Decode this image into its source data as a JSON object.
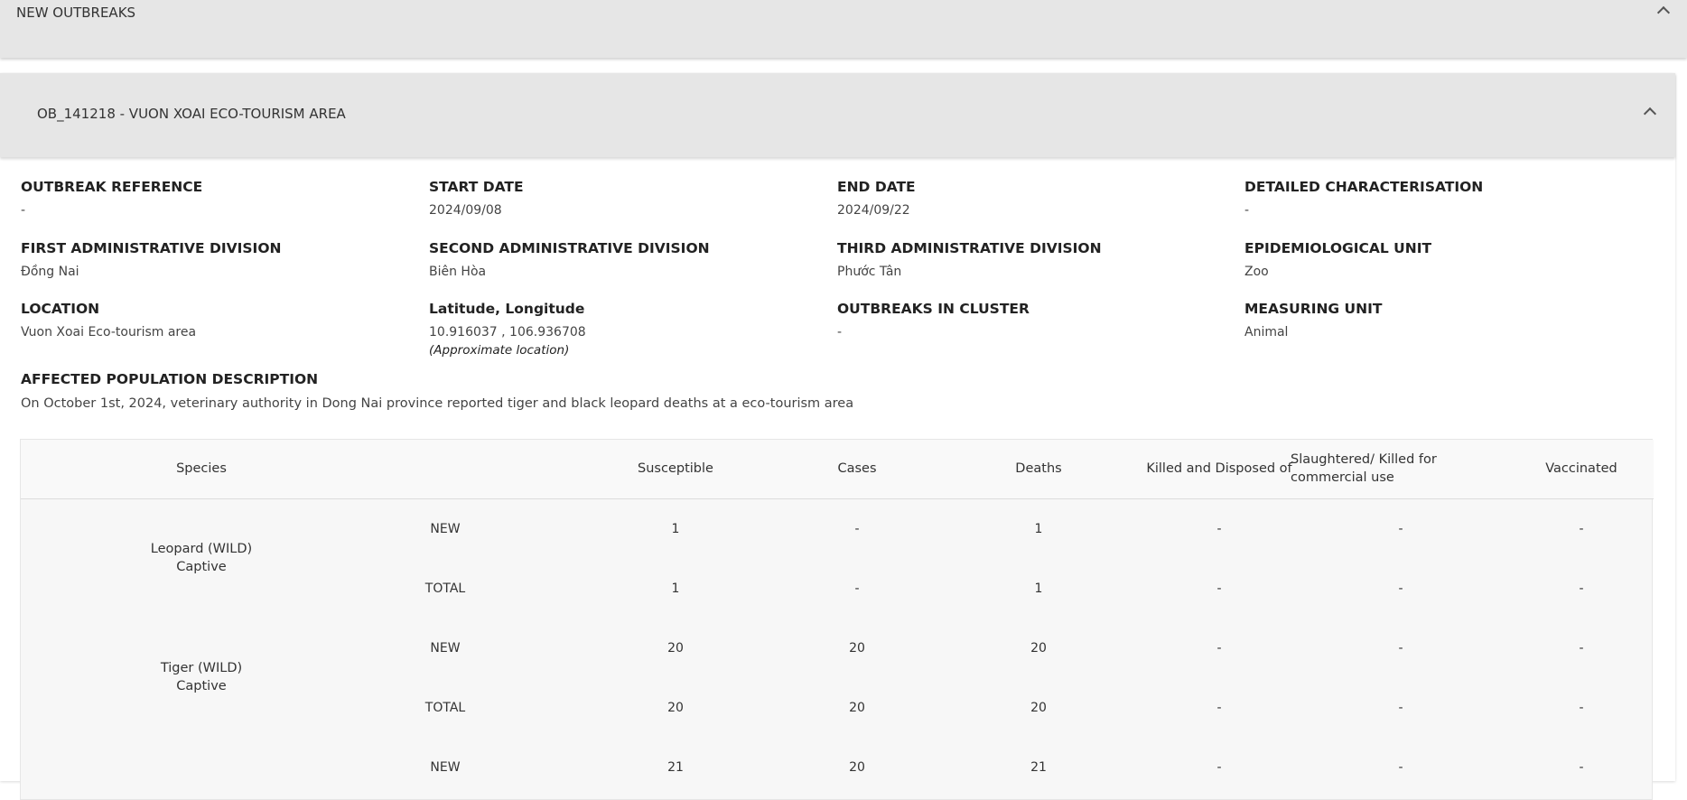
{
  "new_outbreaks": {
    "title": "NEW OUTBREAKS"
  },
  "outbreak": {
    "title": "OB_141218 - VUON XOAI ECO-TOURISM AREA",
    "fields": {
      "outbreak_reference": {
        "label": "OUTBREAK REFERENCE",
        "value": "-"
      },
      "start_date": {
        "label": "START DATE",
        "value": "2024/09/08"
      },
      "end_date": {
        "label": "END DATE",
        "value": "2024/09/22"
      },
      "detailed_characterisation": {
        "label": "DETAILED CHARACTERISATION",
        "value": "-"
      },
      "first_admin": {
        "label": "FIRST ADMINISTRATIVE DIVISION",
        "value": "Đồng Nai"
      },
      "second_admin": {
        "label": "SECOND ADMINISTRATIVE DIVISION",
        "value": "Biên Hòa"
      },
      "third_admin": {
        "label": "THIRD ADMINISTRATIVE DIVISION",
        "value": "Phước Tân"
      },
      "epi_unit": {
        "label": "EPIDEMIOLOGICAL UNIT",
        "value": "Zoo"
      },
      "location": {
        "label": "LOCATION",
        "value": "Vuon Xoai Eco-tourism area"
      },
      "lat_long": {
        "label": "Latitude, Longitude",
        "value": "10.916037 , 106.936708",
        "note": "(Approximate location)"
      },
      "outbreaks_in_cluster": {
        "label": "OUTBREAKS IN CLUSTER",
        "value": "-"
      },
      "measuring_unit": {
        "label": "MEASURING UNIT",
        "value": "Animal"
      }
    },
    "affected_population": {
      "label": "AFFECTED POPULATION DESCRIPTION",
      "value": "On October 1st, 2024, veterinary authority in Dong Nai province reported tiger and black leopard deaths at a eco-tourism area"
    },
    "table": {
      "headers": {
        "species": "Species",
        "susceptible": "Susceptible",
        "cases": "Cases",
        "deaths": "Deaths",
        "killed": "Killed and Disposed of",
        "slaughtered_line1": "Slaughtered/ Killed for",
        "slaughtered_line2": "commercial use",
        "vaccinated": "Vaccinated"
      },
      "species": [
        {
          "name": "Leopard (WILD)",
          "sub": "Captive"
        },
        {
          "name": "Tiger (WILD)",
          "sub": "Captive"
        }
      ],
      "rows": [
        {
          "type": "NEW",
          "susceptible": "1",
          "cases": "-",
          "deaths": "1",
          "killed": "-",
          "slaughtered": "-",
          "vaccinated": "-"
        },
        {
          "type": "TOTAL",
          "susceptible": "1",
          "cases": "-",
          "deaths": "1",
          "killed": "-",
          "slaughtered": "-",
          "vaccinated": "-"
        },
        {
          "type": "NEW",
          "susceptible": "20",
          "cases": "20",
          "deaths": "20",
          "killed": "-",
          "slaughtered": "-",
          "vaccinated": "-"
        },
        {
          "type": "TOTAL",
          "susceptible": "20",
          "cases": "20",
          "deaths": "20",
          "killed": "-",
          "slaughtered": "-",
          "vaccinated": "-"
        },
        {
          "type": "NEW",
          "susceptible": "21",
          "cases": "20",
          "deaths": "21",
          "killed": "-",
          "slaughtered": "-",
          "vaccinated": "-"
        }
      ]
    }
  }
}
